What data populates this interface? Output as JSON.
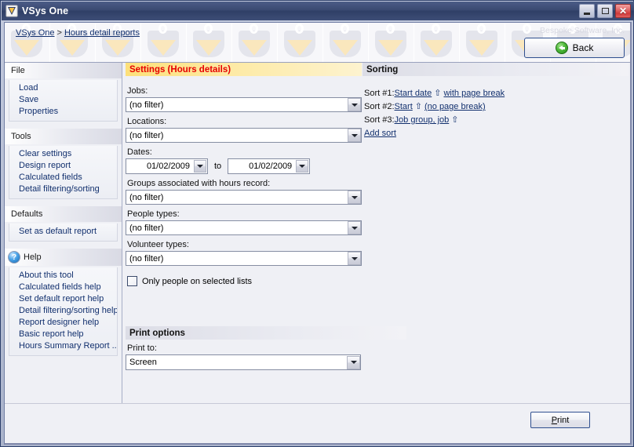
{
  "window": {
    "title": "VSys One",
    "icon": "vsys-logo-icon",
    "minimize_label": "Minimize",
    "maximize_label": "Maximize",
    "close_label": "Close"
  },
  "banner": {
    "breadcrumb": {
      "root": "VSys One",
      "separator": ">",
      "current": "Hours detail reports"
    },
    "watermark": "Bespoke Software, Inc.",
    "back_label": "Back"
  },
  "sidebar": {
    "sections": [
      {
        "header": "File",
        "icon": null,
        "links": [
          "Load",
          "Save",
          "Properties"
        ]
      },
      {
        "header": "Tools",
        "icon": null,
        "links": [
          "Clear settings",
          "Design report",
          "Calculated fields",
          "Detail filtering/sorting"
        ]
      },
      {
        "header": "Defaults",
        "icon": null,
        "links": [
          "Set as default report"
        ]
      },
      {
        "header": "Help",
        "icon": "help-question-icon",
        "links": [
          "About this tool",
          "Calculated fields help",
          "Set default report help",
          "Detail filtering/sorting help",
          "Report designer help",
          "Basic report help",
          "Hours Summary Report ..."
        ]
      }
    ]
  },
  "settings": {
    "header": "Settings (Hours details)",
    "fields": [
      {
        "label": "Jobs:",
        "value": "(no filter)"
      },
      {
        "label": "Locations:",
        "value": "(no filter)"
      }
    ],
    "dates": {
      "label": "Dates:",
      "from": "01/02/2009",
      "to_word": "to",
      "to": "01/02/2009"
    },
    "fields2": [
      {
        "label": "Groups associated with hours record:",
        "value": "(no filter)"
      },
      {
        "label": "People types:",
        "value": "(no filter)"
      },
      {
        "label": "Volunteer types:",
        "value": "(no filter)"
      }
    ],
    "checkbox": {
      "label": "Only people on selected lists",
      "checked": false
    }
  },
  "sorting": {
    "header": "Sorting",
    "rows": [
      {
        "prefix": "Sort #1:",
        "field": "Start date",
        "direction": "up",
        "page_break": "with page break"
      },
      {
        "prefix": "Sort #2:",
        "field": "Start",
        "direction": "up",
        "page_break": "(no page break)"
      },
      {
        "prefix": "Sort #3:",
        "field": "Job group, job",
        "direction": "up",
        "page_break": ""
      }
    ],
    "add_label": "Add sort",
    "direction_glyph": "⇧"
  },
  "print_options": {
    "header": "Print options",
    "print_to_label": "Print to:",
    "print_to_value": "Screen"
  },
  "footer": {
    "print_button_accel": "P",
    "print_button_rest": "rint"
  },
  "colors": {
    "settings_header_text": "#e60000",
    "link": "#12306e",
    "titlebar": "#3a4a72",
    "close_button": "#cf3a3a"
  }
}
